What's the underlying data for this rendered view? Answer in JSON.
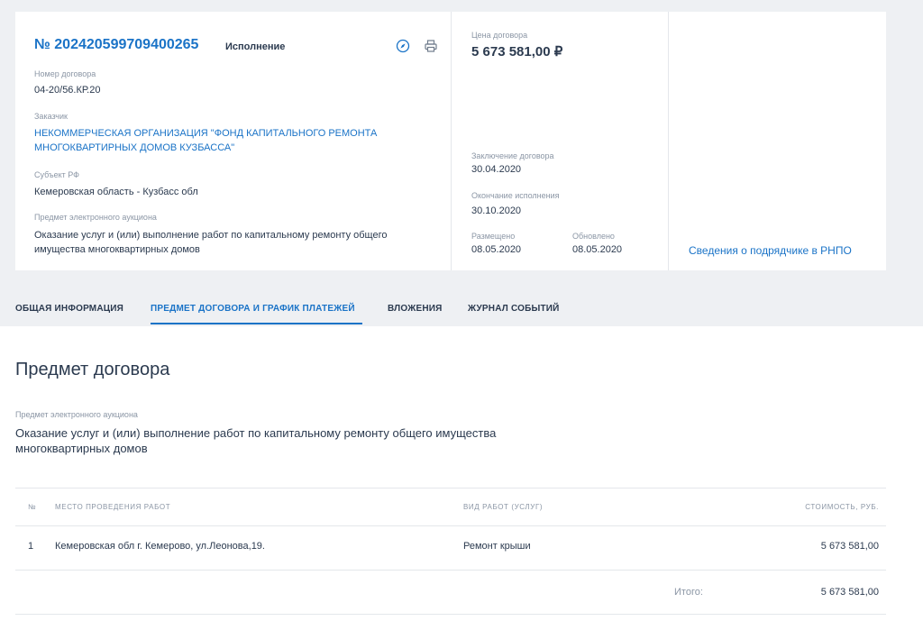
{
  "contract": {
    "number": "№ 202420599709400265",
    "status": "Исполнение",
    "contract_number_label": "Номер договора",
    "contract_number": "04-20/56.КР.20",
    "customer_label": "Заказчик",
    "customer": "НЕКОММЕРЧЕСКАЯ ОРГАНИЗАЦИЯ \"ФОНД КАПИТАЛЬНОГО РЕМОНТА МНОГОКВАРТИРНЫХ ДОМОВ КУЗБАССА\"",
    "region_label": "Субъект РФ",
    "region": "Кемеровская область - Кузбасс обл",
    "subject_label": "Предмет электронного аукциона",
    "subject": "Оказание услуг и (или) выполнение работ по капитальному ремонту общего имущества многоквартирных домов"
  },
  "price": {
    "label": "Цена договора",
    "value": "5 673 581,00 ₽"
  },
  "dates": {
    "conclusion_label": "Заключение договора",
    "conclusion": "30.04.2020",
    "end_label": "Окончание исполнения",
    "end": "30.10.2020",
    "posted_label": "Размещено",
    "posted": "08.05.2020",
    "updated_label": "Обновлено",
    "updated": "08.05.2020"
  },
  "rnpo_link": "Сведения о подрядчике в РНПО",
  "tabs": [
    {
      "label": "ОБЩАЯ ИНФОРМАЦИЯ"
    },
    {
      "label": "ПРЕДМЕТ ДОГОВОРА И ГРАФИК ПЛАТЕЖЕЙ"
    },
    {
      "label": "ВЛОЖЕНИЯ"
    },
    {
      "label": "ЖУРНАЛ СОБЫТИЙ"
    }
  ],
  "section": {
    "title": "Предмет договора",
    "subject_label": "Предмет электронного аукциона",
    "subject": "Оказание услуг и (или) выполнение работ по капитальному ремонту общего имущества многоквартирных домов"
  },
  "table": {
    "headers": {
      "no": "№",
      "place": "МЕСТО ПРОВЕДЕНИЯ РАБОТ",
      "kind": "ВИД РАБОТ (УСЛУГ)",
      "cost": "СТОИМОСТЬ, РУБ."
    },
    "rows": [
      {
        "no": "1",
        "place": "Кемеровская обл г. Кемерово, ул.Леонова,19.",
        "kind": "Ремонт крыши",
        "cost": "5 673 581,00"
      }
    ],
    "total_label": "Итого:",
    "total": "5 673 581,00"
  },
  "icons": {
    "compass": "compass-icon",
    "print": "printer-icon"
  },
  "colors": {
    "accent": "#1a73c7",
    "text": "#2b3a4f",
    "muted": "#8b96a5",
    "background": "#eef0f3"
  }
}
